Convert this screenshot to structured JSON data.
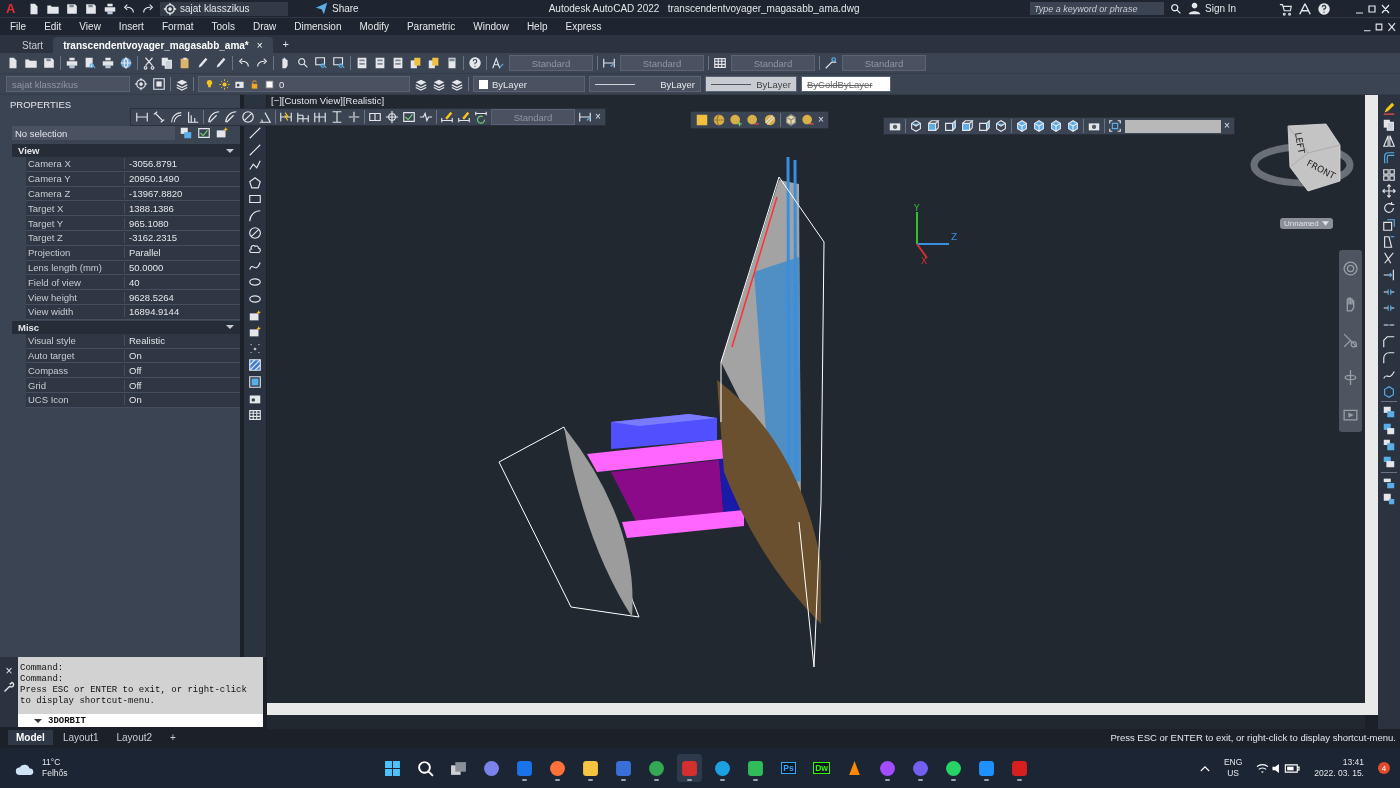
{
  "title_bar": {
    "app_menu": "A",
    "workspace": "sajat klasszikus",
    "share": "Share",
    "app_name": "Autodesk AutoCAD 2022",
    "file_name": "transcendentvoyager_magasabb_ama.dwg",
    "search": {
      "placeholder": "Type a keyword or phrase"
    },
    "sign_in": "Sign In"
  },
  "menu": [
    "File",
    "Edit",
    "View",
    "Insert",
    "Format",
    "Tools",
    "Draw",
    "Dimension",
    "Modify",
    "Parametric",
    "Window",
    "Help",
    "Express"
  ],
  "doc_tabs": [
    {
      "label": "Start",
      "selected": false
    },
    {
      "label": "transcendentvoyager_magasabb_ama*",
      "selected": true
    }
  ],
  "doc_tab_close": "×",
  "new_tab": "+",
  "standard_toolbar": {
    "text_style": "Standard",
    "dim_style": "Standard",
    "table_style": "Standard",
    "mleader_style": "Standard"
  },
  "layers_toolbar": {
    "workspace": "sajat klasszikus",
    "layer": "0",
    "color_name": "ByLayer",
    "linetype": "ByLayer",
    "lineweight": "ByLayer",
    "plot_style": "ByColdByLayer"
  },
  "properties": {
    "title": "PROPERTIES",
    "selection": "No selection",
    "sections": [
      {
        "title": "View",
        "expanded": true,
        "rows": [
          {
            "name": "Camera X",
            "value": "-3056.8791"
          },
          {
            "name": "Camera Y",
            "value": "20950.1490"
          },
          {
            "name": "Camera Z",
            "value": "-13967.8820"
          },
          {
            "name": "Target X",
            "value": "1388.1386"
          },
          {
            "name": "Target Y",
            "value": "965.1080"
          },
          {
            "name": "Target Z",
            "value": "-3162.2315"
          },
          {
            "name": "Projection",
            "value": "Parallel"
          },
          {
            "name": "Lens length (mm)",
            "value": "50.0000"
          },
          {
            "name": "Field of view",
            "value": "40"
          },
          {
            "name": "View height",
            "value": "9628.5264"
          },
          {
            "name": "View width",
            "value": "16894.9144"
          }
        ]
      },
      {
        "title": "Misc",
        "expanded": true,
        "rows": [
          {
            "name": "Visual style",
            "value": "Realistic"
          },
          {
            "name": "Auto target",
            "value": "On"
          },
          {
            "name": "Compass",
            "value": "Off"
          },
          {
            "name": "Grid",
            "value": "Off"
          },
          {
            "name": "UCS Icon",
            "value": "On"
          }
        ]
      }
    ]
  },
  "viewport": {
    "label": "[−][Custom View][Realistic]",
    "dim_toolbar": {
      "style": "Standard",
      "close": "×"
    },
    "render_toolbar": {
      "close": "×"
    },
    "view_toolbar": {
      "close": "×"
    },
    "ucs": {
      "y": "Y",
      "z": "Z",
      "x": "X"
    },
    "viewcube": {
      "faces": [
        "LEFT",
        "FRONT"
      ],
      "view_name": "Unnamed"
    }
  },
  "command_line": {
    "close": "×",
    "history": [
      "Command:",
      "Command:",
      "Press ESC or ENTER to exit, or right-click",
      "to display shortcut-menu."
    ],
    "input": "3DORBIT"
  },
  "layout_tabs": [
    {
      "label": "Model",
      "selected": true
    },
    {
      "label": "Layout1",
      "selected": false
    },
    {
      "label": "Layout2",
      "selected": false
    }
  ],
  "add_layout": "+",
  "status_bar": {
    "prompt": "Press ESC or ENTER to exit, or right-click to display shortcut-menu."
  },
  "taskbar": {
    "weather_temp": "11°C",
    "weather_text": "Felhős",
    "apps": [
      {
        "kind": "start",
        "color": "#4cc2ff",
        "running": false,
        "selected": false
      },
      {
        "kind": "search",
        "color": "#ffffff",
        "running": false,
        "selected": false
      },
      {
        "kind": "pair",
        "color": "#d0d0d0",
        "running": false,
        "selected": false
      },
      {
        "kind": "circle",
        "color": "#7b83eb",
        "running": false,
        "selected": false
      },
      {
        "kind": "tile",
        "color": "#1a73e8",
        "running": true,
        "selected": false
      },
      {
        "kind": "circle",
        "color": "#ff7139",
        "running": true,
        "selected": false
      },
      {
        "kind": "tile",
        "color": "#f5c542",
        "running": true,
        "selected": false
      },
      {
        "kind": "tile",
        "color": "#3a6fd8",
        "running": true,
        "selected": false
      },
      {
        "kind": "circle",
        "color": "#34a853",
        "running": true,
        "selected": false
      },
      {
        "kind": "tile",
        "color": "#d32f2f",
        "running": true,
        "selected": true
      },
      {
        "kind": "circle",
        "color": "#1ba1e2",
        "running": true,
        "selected": false
      },
      {
        "kind": "tile",
        "color": "#2ebd59",
        "running": true,
        "selected": false
      },
      {
        "kind": "label",
        "color": "#31a8ff",
        "label": "Ps",
        "running": false,
        "selected": false
      },
      {
        "kind": "label",
        "color": "#35fa00",
        "label": "Dw",
        "running": false,
        "selected": false
      },
      {
        "kind": "cone",
        "color": "#ff8800",
        "running": false,
        "selected": false
      },
      {
        "kind": "circle",
        "color": "#a34cff",
        "running": true,
        "selected": false
      },
      {
        "kind": "circle",
        "color": "#7360f2",
        "running": true,
        "selected": false
      },
      {
        "kind": "circle",
        "color": "#25d366",
        "running": true,
        "selected": false
      },
      {
        "kind": "tile",
        "color": "#1e90ff",
        "running": true,
        "selected": false
      },
      {
        "kind": "tile",
        "color": "#d71f1f",
        "running": true,
        "selected": false
      }
    ],
    "language": "ENG",
    "region": "US",
    "time": "13:41",
    "date": "2022. 03. 15.",
    "notifications": "4"
  }
}
